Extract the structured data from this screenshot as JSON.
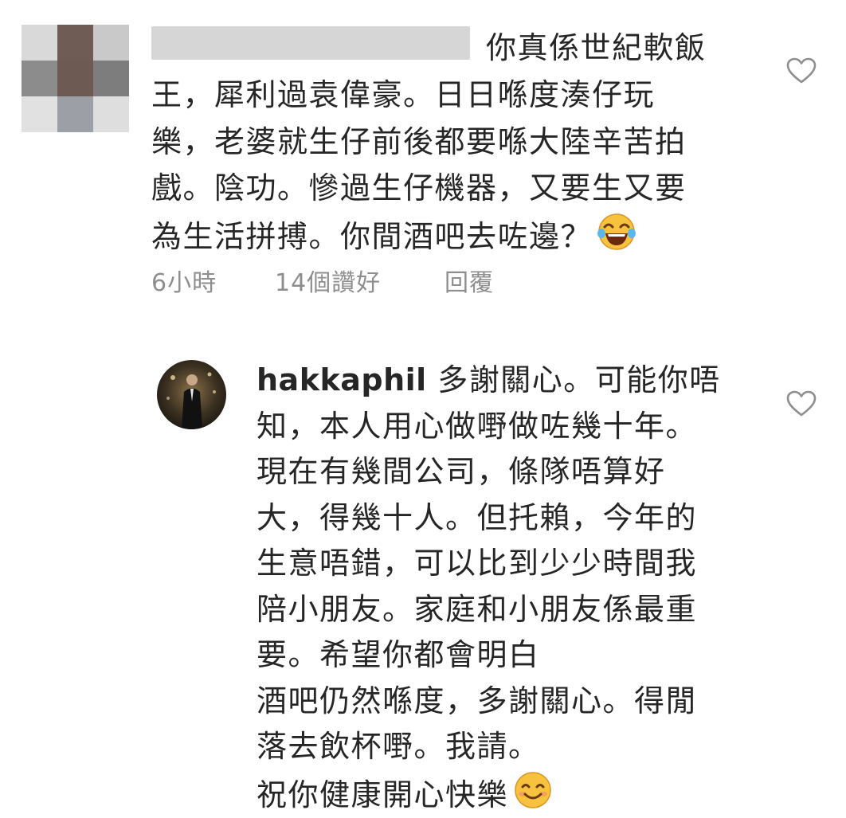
{
  "comments": [
    {
      "username": "",
      "text_line1": "你真係世紀軟飯",
      "text_rest": "王，犀利過袁偉豪。日日喺度湊仔玩\n樂，老婆就生仔前後都要喺大陸辛苦拍\n戲。陰功。慘過生仔機器，又要生又要\n為生活拼搏。你間酒吧去咗邊？",
      "emoji": "face-with-tears-of-joy",
      "time": "6小時",
      "likes": "14個讚好",
      "reply_label": "回覆"
    },
    {
      "username": "hakkaphil",
      "text_line1": " 多謝關心。可能你唔",
      "text_rest": "知，本人用心做嘢做咗幾十年。\n現在有幾間公司，條隊唔算好\n大，得幾十人。但托賴，今年的\n生意唔錯，可以比到少少時間我\n陪小朋友。家庭和小朋友係最重\n要。希望你都會明白\n酒吧仍然喺度，多謝關心。得閒\n落去飲杯嘢。我請。\n祝你健康開心快樂",
      "emoji": "smiling-face"
    }
  ],
  "colors": {
    "text": "#262626",
    "meta": "#8e8e8e",
    "heart_outline": "#8e8e8e",
    "redacted": "#d6d6d6"
  },
  "icons": [
    "heart-outline-icon",
    "face-with-tears-of-joy",
    "smiling-face"
  ]
}
